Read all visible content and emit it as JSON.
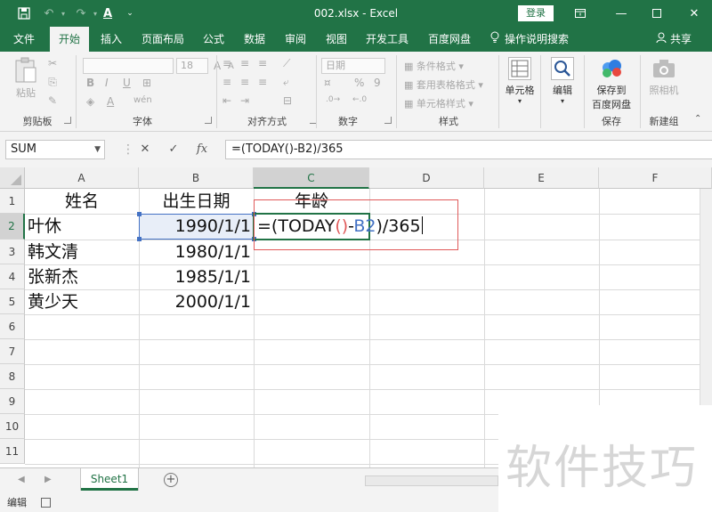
{
  "window": {
    "title": "002.xlsx  -  Excel",
    "login_label": "登录",
    "font_color_letter": "A"
  },
  "tabs": [
    {
      "label": "文件"
    },
    {
      "label": "开始"
    },
    {
      "label": "插入"
    },
    {
      "label": "页面布局"
    },
    {
      "label": "公式"
    },
    {
      "label": "数据"
    },
    {
      "label": "审阅"
    },
    {
      "label": "视图"
    },
    {
      "label": "开发工具"
    },
    {
      "label": "百度网盘"
    }
  ],
  "active_tab": "开始",
  "tell_me": "操作说明搜索",
  "share": "共享",
  "ribbon": {
    "clipboard": {
      "label": "剪贴板",
      "paste": "粘贴"
    },
    "font": {
      "label": "字体",
      "font_size": "18",
      "bold": "B",
      "italic": "I",
      "underline": "U",
      "grow": "A",
      "shrink": "A",
      "font_color": "A",
      "phonetic": "wén"
    },
    "alignment": {
      "label": "对齐方式"
    },
    "number": {
      "label": "数字",
      "format": "日期",
      "percent": "%",
      "comma": "9"
    },
    "styles": {
      "label": "样式",
      "conditional": "条件格式",
      "table": "套用表格格式",
      "cell_styles": "单元格样式"
    },
    "cells": {
      "label": "单元格"
    },
    "editing": {
      "label": "编辑"
    },
    "save_group": {
      "label": "保存",
      "button": "保存到百度网盘",
      "line1": "保存到",
      "line2": "百度网盘"
    },
    "new_group": {
      "label": "新建组",
      "button": "照相机"
    }
  },
  "formula_bar": {
    "name_box": "SUM",
    "cancel": "✕",
    "enter": "✓",
    "fx": "fx",
    "formula": "=(TODAY()-B2)/365"
  },
  "columns": [
    "A",
    "B",
    "C",
    "D",
    "E",
    "F"
  ],
  "rows": [
    "1",
    "2",
    "3",
    "4",
    "5",
    "6",
    "7",
    "8",
    "9",
    "10",
    "11"
  ],
  "cells": {
    "A1": "姓名",
    "B1": "出生日期",
    "C1": "年龄",
    "A2": "叶休",
    "B2": "1990/1/1",
    "A3": "韩文清",
    "B3": "1980/1/1",
    "A4": "张新杰",
    "B4": "1985/1/1",
    "A5": "黄少天",
    "B5": "2000/1/1"
  },
  "edit_formula": {
    "prefix": "=(TODAY",
    "paren": "()",
    "dash": "-",
    "ref": "B2",
    "suffix": ")/365"
  },
  "colors": {
    "accent": "#217346",
    "ref_blue": "#4472c4",
    "paren_red": "#e05a5a",
    "highlight_box": "#e05a5a"
  },
  "sheets": [
    {
      "label": "Sheet1",
      "active": true
    }
  ],
  "status": {
    "mode": "编辑"
  },
  "watermark": "软件技巧"
}
